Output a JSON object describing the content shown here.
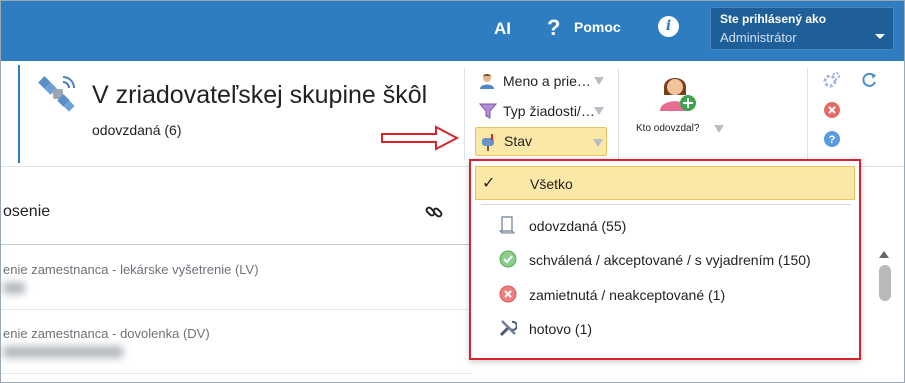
{
  "topbar": {
    "ai_label": "AI",
    "help_label": "Pomoc",
    "help_icon": "?",
    "info_icon": "i",
    "user_line1": "Ste prihlásený ako",
    "user_line2": "Administrátor"
  },
  "header": {
    "title": "V zriadovateľskej skupine škôl",
    "subtitle": "odovzdaná (6)"
  },
  "filters": {
    "name_label": "Meno a prie…",
    "type_label": "Typ žiadosti/…",
    "state_label": "Stav"
  },
  "kto": {
    "label": "Kto odovzdal?"
  },
  "list": {
    "column_title": "osenie",
    "rows": [
      {
        "title": "enie zamestnanca - lekárske vyšetrenie (LV)"
      },
      {
        "title": "enie zamestnanca - dovolenka (DV)"
      }
    ]
  },
  "dropdown": {
    "selected_mark": "✓",
    "items": [
      {
        "label": "Všetko",
        "icon": "none"
      },
      {
        "label": "odovzdaná (55)",
        "icon": "document-icon"
      },
      {
        "label": "schválená / akceptované / s vyjadrením (150)",
        "icon": "check-circle-icon"
      },
      {
        "label": "zamietnutá / neakceptované (1)",
        "icon": "x-circle-icon"
      },
      {
        "label": "hotovo (1)",
        "icon": "tools-icon"
      }
    ]
  },
  "colors": {
    "topbar": "#2f7dc1",
    "selected_bg": "#fbe8a7",
    "highlight_border": "#d9232e"
  }
}
